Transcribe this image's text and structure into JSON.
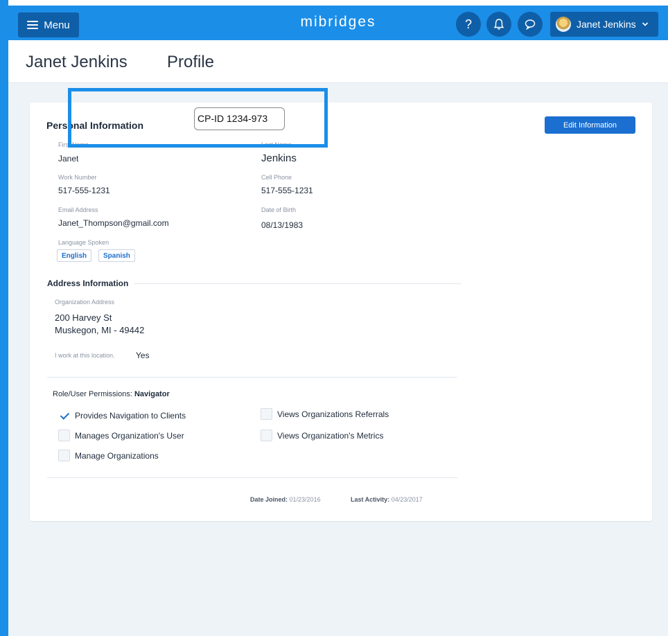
{
  "topbar": {
    "menu_label": "Menu",
    "brand": "mibridges",
    "help_glyph": "?",
    "user_name": "Janet Jenkins",
    "icons": [
      "hamburger-icon",
      "help-icon",
      "bell-icon",
      "chat-icon",
      "avatar",
      "chevron-down-icon"
    ]
  },
  "header": {
    "name": "Janet Jenkins",
    "section": "Profile"
  },
  "overlay": {
    "cp_id": "CP-ID 1234-973"
  },
  "personal": {
    "title": "Personal Information",
    "edit_label": "Edit Information",
    "first_name_label": "First Name",
    "first_name": "Janet",
    "last_name_label": "Last Name",
    "last_name": "Jenkins",
    "work_label": "Work Number",
    "work": "517-555-1231",
    "cell_label": "Cell Phone",
    "cell": "517-555-1231",
    "email_label": "Email Address",
    "email": "Janet_Thompson@gmail.com",
    "dob_label": "Date of Birth",
    "dob": "08/13/1983",
    "language_label": "Language Spoken",
    "languages": [
      "English",
      "Spanish"
    ]
  },
  "address": {
    "title": "Address Information",
    "org_label": "Organization Address",
    "line1": "200 Harvey St",
    "line2": "Muskegon, MI - 49442",
    "works_here_label": "I work at this location.",
    "works_here_value": "Yes"
  },
  "permissions": {
    "prefix": "Role/User Permissions:",
    "role": "Navigator",
    "items": [
      {
        "label": "Provides Navigation to Clients",
        "checked": true
      },
      {
        "label": "Manages Organization's User",
        "checked": false
      },
      {
        "label": "Manage Organizations",
        "checked": false
      },
      {
        "label": "Views Organizations Referrals",
        "checked": false
      },
      {
        "label": "Views Organization's Metrics",
        "checked": false
      }
    ]
  },
  "footer": {
    "joined_label": "Date Joined:",
    "joined": "01/23/2016",
    "activity_label": "Last Activity:",
    "activity": "04/23/2017"
  },
  "colors": {
    "brand_blue": "#1b8ee8",
    "dark_blue": "#0f5fa8",
    "button_blue": "#1b6fd0",
    "page_bg": "#eef3f8"
  }
}
